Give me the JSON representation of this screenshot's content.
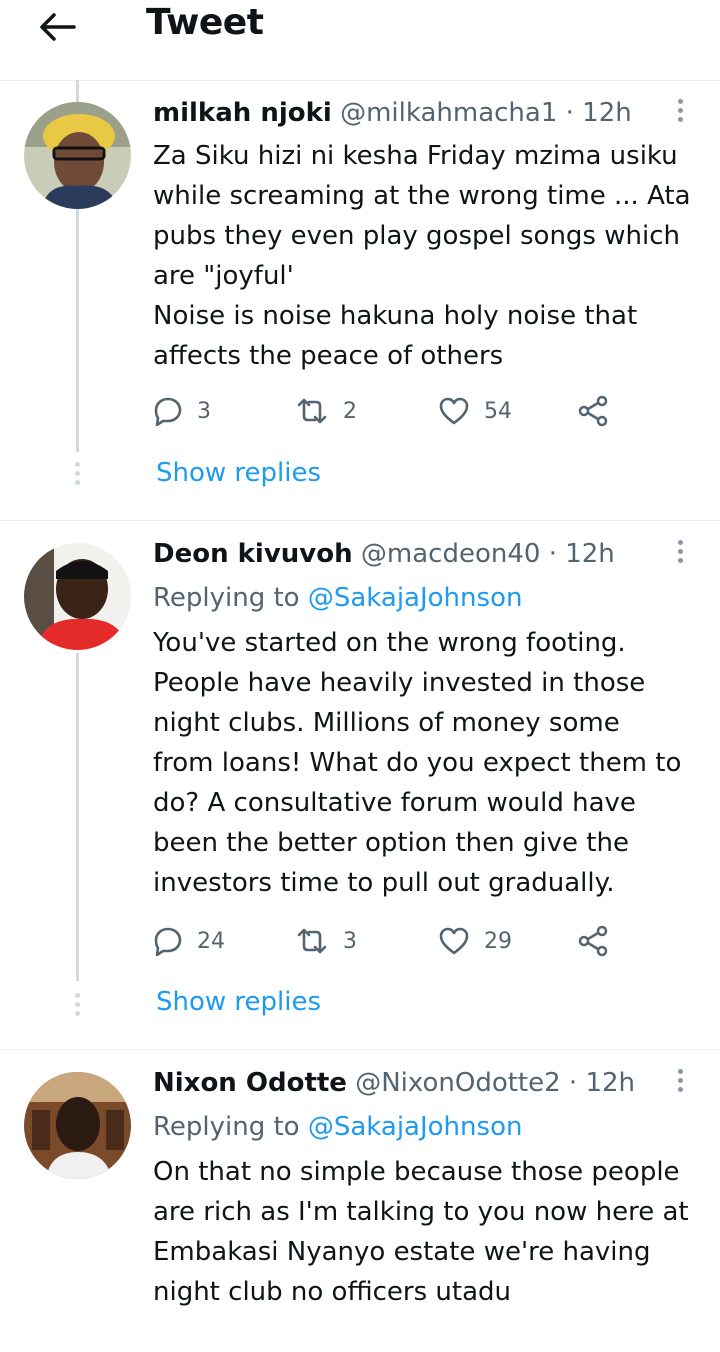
{
  "header": {
    "title": "Tweet",
    "back_icon": "arrow-left-icon"
  },
  "tweets": [
    {
      "name": "milkah njoki",
      "handle": "@milkahmacha1",
      "sep": "·",
      "time": "12h",
      "replying_prefix": "",
      "replying_to": "",
      "lines": [
        "Za Siku hizi ni kesha Friday mzima usiku",
        "while screaming at the wrong time ... Ata",
        "pubs they even play gospel songs which",
        "are \"joyful'",
        "Noise is noise hakuna holy noise that",
        "affects the peace of others"
      ],
      "reply_count": "3",
      "retweet_count": "2",
      "like_count": "54",
      "show_replies": "Show replies"
    },
    {
      "name": "Deon kivuvoh",
      "handle": "@macdeon40",
      "sep": "·",
      "time": "12h",
      "replying_prefix": "Replying to ",
      "replying_to": "@SakajaJohnson",
      "lines": [
        "You've started on the wrong footing.",
        "People have heavily invested in those",
        "night clubs. Millions of money  some",
        "from loans! What do you expect them to",
        "do?  A consultative forum would have",
        "been the better option  then give the",
        "investors time to pull out gradually."
      ],
      "reply_count": "24",
      "retweet_count": "3",
      "like_count": "29",
      "show_replies": "Show replies"
    },
    {
      "name": "Nixon Odotte",
      "handle": "@NixonOdotte2",
      "sep": "·",
      "time": "12h",
      "replying_prefix": "Replying to ",
      "replying_to": "@SakajaJohnson",
      "lines": [
        "On that no simple because those people",
        "are rich as I'm talking to you now here at",
        "Embakasi Nyanyo estate we're having",
        "night club no officers  utadu"
      ]
    }
  ],
  "colors": {
    "accent": "#1d9bf0",
    "secondary_text": "#536471",
    "thread_line": "#cfd9de"
  }
}
